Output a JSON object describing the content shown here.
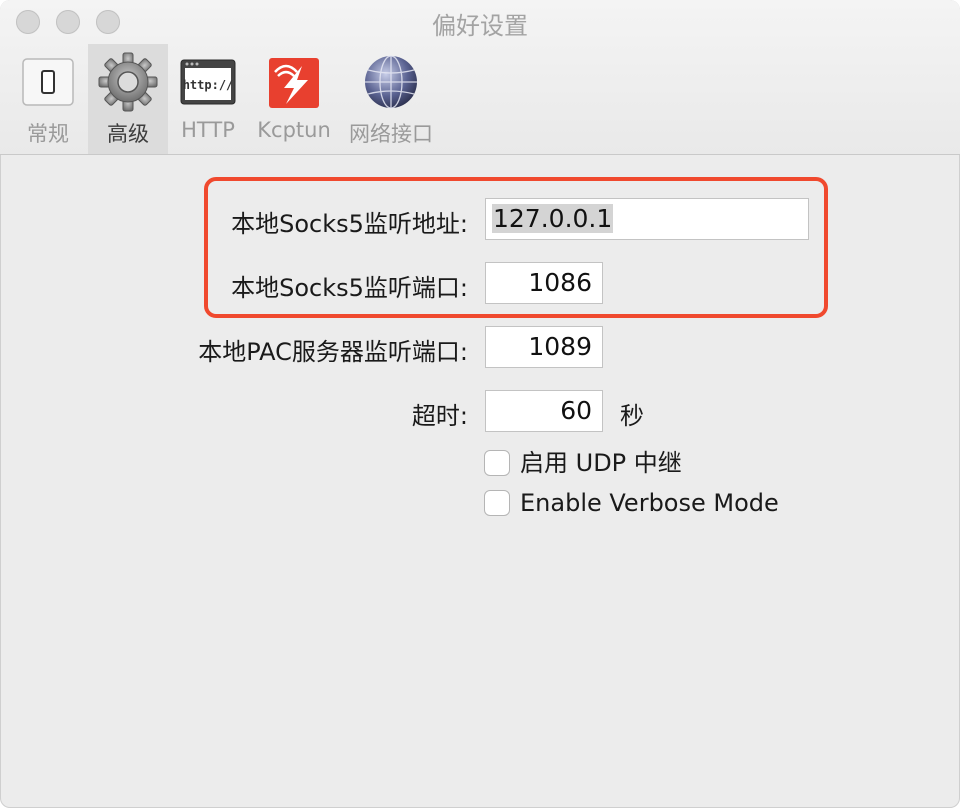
{
  "window": {
    "title": "偏好设置"
  },
  "toolbar": {
    "tabs": [
      {
        "label": "常规",
        "icon": "switch-icon",
        "selected": false
      },
      {
        "label": "高级",
        "icon": "gear-icon",
        "selected": true
      },
      {
        "label": "HTTP",
        "icon": "http-window-icon",
        "selected": false
      },
      {
        "label": "Kcptun",
        "icon": "kcptun-icon",
        "selected": false
      },
      {
        "label": "网络接口",
        "icon": "globe-icon",
        "selected": false
      }
    ]
  },
  "form": {
    "socks5_address": {
      "label": "本地Socks5监听地址:",
      "value": "127.0.0.1"
    },
    "socks5_port": {
      "label": "本地Socks5监听端口:",
      "value": "1086"
    },
    "pac_port": {
      "label": "本地PAC服务器监听端口:",
      "value": "1089"
    },
    "timeout": {
      "label": "超时:",
      "value": "60",
      "unit": "秒"
    },
    "udp_relay": {
      "label": "启用 UDP 中继",
      "checked": false
    },
    "verbose_mode": {
      "label": "Enable Verbose Mode",
      "checked": false
    }
  },
  "colors": {
    "highlight": "#f0492e",
    "kcptun_red": "#e8402f"
  }
}
